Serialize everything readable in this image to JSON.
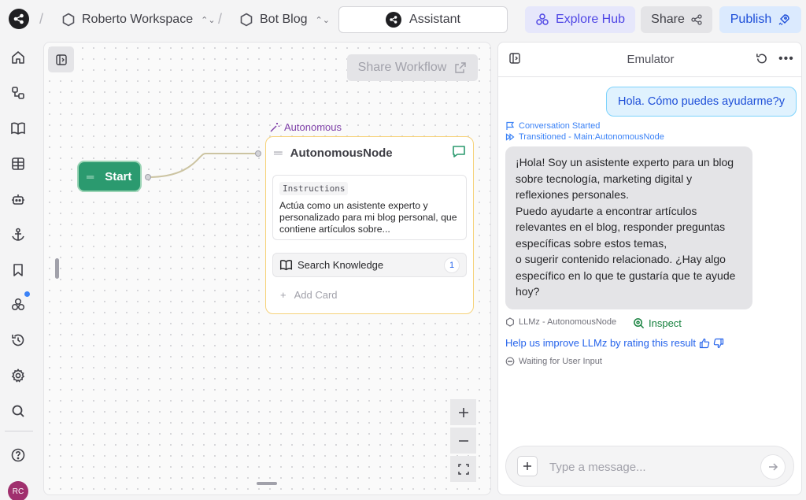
{
  "header": {
    "workspace_name": "Roberto Workspace",
    "bot_name": "Bot Blog",
    "assistant_label": "Assistant",
    "explore_label": "Explore Hub",
    "share_label": "Share",
    "publish_label": "Publish"
  },
  "sidebar": {
    "icons": [
      "home-icon",
      "flow-icon",
      "book-icon",
      "table-icon",
      "bot-icon",
      "anchor-icon",
      "bookmark-icon",
      "integrations-icon",
      "history-icon",
      "settings-icon",
      "search-icon",
      "help-icon"
    ],
    "user_initials": "RC"
  },
  "canvas": {
    "share_workflow_label": "Share Workflow",
    "start_node_label": "Start",
    "autonomous_tag": "Autonomous",
    "autonomous_node_title": "AutonomousNode",
    "instructions_label": "Instructions",
    "instructions_text": "Actúa como un asistente experto y personalizado para mi blog personal, que contiene artículos sobre...",
    "knowledge_card_label": "Search Knowledge",
    "knowledge_card_count": "1",
    "add_card_label": "Add Card"
  },
  "emulator": {
    "title": "Emulator",
    "user_message": "Hola. Cómo puedes ayudarme?y",
    "event_started": "Conversation Started",
    "event_transitioned": "Transitioned - Main:AutonomousNode",
    "bot_message_lines": [
      "¡Hola! Soy un asistente experto para un blog sobre tecnología, marketing digital y reflexiones personales.",
      "Puedo ayudarte a encontrar artículos relevantes en el blog, responder preguntas específicas sobre estos temas,",
      "o sugerir contenido relacionado. ¿Hay algo específico en lo que te gustaría que te ayude hoy?"
    ],
    "source_label": "LLMz - AutonomousNode",
    "inspect_label": "Inspect",
    "rate_label": "Help us improve LLMz by rating this result",
    "waiting_label": "Waiting for User Input",
    "input_placeholder": "Type a message...",
    "input_value": ""
  },
  "colors": {
    "accent_green": "#2b9a6f",
    "node_border": "#f6d27a",
    "user_bubble": "#e0f2fe",
    "link_blue": "#2563eb",
    "autonomous_purple": "#7e3fa8",
    "avatar": "#a0306e"
  }
}
